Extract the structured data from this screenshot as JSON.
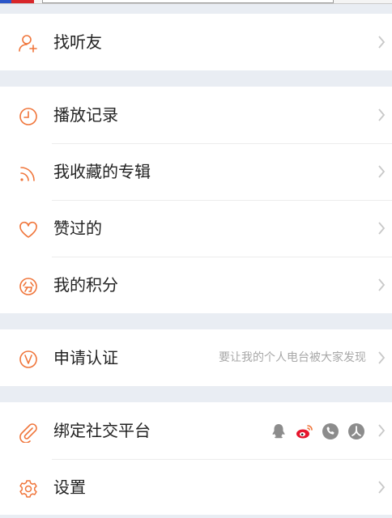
{
  "colors": {
    "accent": "#f0753a",
    "text": "#222222",
    "hint": "#a8a8a8",
    "chevron": "#c8c8c8",
    "divider": "#ececec",
    "section_gap": "#e9edf3",
    "weibo": "#e6162d",
    "social_gray": "#8c8c8c"
  },
  "menu": {
    "find_friends": {
      "label": "找听友",
      "icon": "add-user-icon"
    },
    "play_history": {
      "label": "播放记录",
      "icon": "clock-icon"
    },
    "favorite_albums": {
      "label": "我收藏的专辑",
      "icon": "rss-icon"
    },
    "liked": {
      "label": "赞过的",
      "icon": "heart-icon"
    },
    "my_points": {
      "label": "我的积分",
      "icon": "points-icon"
    },
    "verification": {
      "label": "申请认证",
      "hint": "要让我的个人电台被大家发现",
      "icon": "verified-icon"
    },
    "bind_social": {
      "label": "绑定社交平台",
      "icon": "paperclip-icon",
      "platforms": [
        "qq-icon",
        "weibo-icon",
        "phone-icon",
        "renren-icon"
      ]
    },
    "settings": {
      "label": "设置",
      "icon": "gear-icon"
    }
  }
}
